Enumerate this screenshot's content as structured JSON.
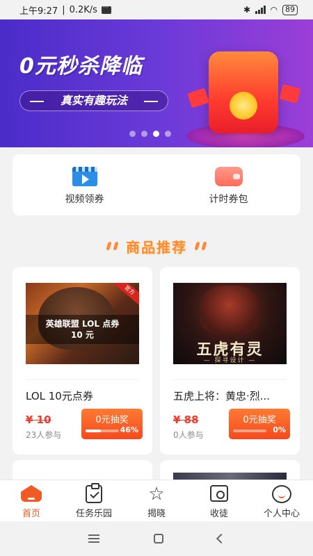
{
  "status_bar": {
    "time": "上午9:27",
    "speed": "0.2K/s",
    "battery": "89"
  },
  "banner": {
    "title": "0元秒杀降临",
    "subtitle": "真实有趣玩法",
    "slide_count": 4,
    "active_slide": 3
  },
  "quick_actions": [
    {
      "label": "视频领券",
      "icon": "video-icon"
    },
    {
      "label": "计时券包",
      "icon": "wallet-icon"
    }
  ],
  "section": {
    "title": "商品推荐"
  },
  "products": [
    {
      "image_caption_line1": "英雄联盟 LOL 点券",
      "image_caption_line2": "10 元",
      "image_corner_tag": "官方",
      "name": "LOL 10元点券",
      "price": "¥ 10",
      "joined": "23人参与",
      "button_label": "0元抽奖",
      "progress_percent": 46,
      "progress_label": "46%"
    },
    {
      "image_title": "五虎有灵",
      "image_subtitle": "— 探寻设计 —",
      "name": "五虎上将：黄忠·烈...",
      "price": "¥ 88",
      "joined": "0人参与",
      "button_label": "0元抽奖",
      "progress_percent": 0,
      "progress_label": "0%"
    }
  ],
  "bottom_nav": [
    {
      "label": "首页",
      "icon": "home-icon",
      "active": true
    },
    {
      "label": "任务乐园",
      "icon": "task-clipboard-icon",
      "active": false
    },
    {
      "label": "揭晓",
      "icon": "star-icon",
      "active": false
    },
    {
      "label": "收徒",
      "icon": "scroll-icon",
      "active": false
    },
    {
      "label": "个人中心",
      "icon": "person-icon",
      "active": false
    }
  ],
  "colors": {
    "accent": "#f05a24",
    "banner_start": "#4b2cc8",
    "banner_end": "#9b3ed7",
    "price_red": "#ee3a2a"
  }
}
